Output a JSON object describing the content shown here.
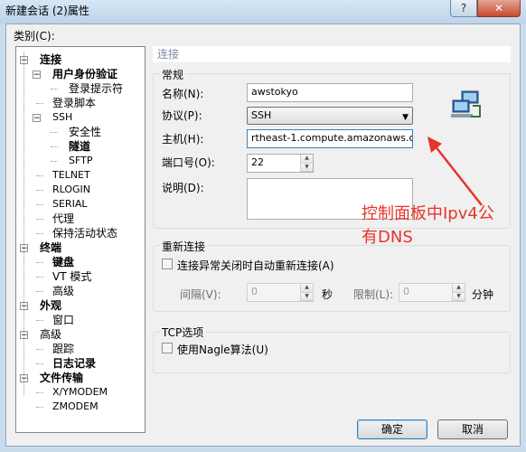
{
  "window": {
    "title": "新建会话 (2)属性",
    "help_label": "?",
    "close_label": "✕"
  },
  "category_label": "类别(C):",
  "tree": [
    {
      "label": "连接",
      "bold": true,
      "level": 0,
      "toggle": "⊟"
    },
    {
      "label": "用户身份验证",
      "bold": true,
      "level": 1,
      "toggle": "⊟"
    },
    {
      "label": "登录提示符",
      "bold": false,
      "level": 2
    },
    {
      "label": "登录脚本",
      "bold": false,
      "level": 1
    },
    {
      "label": "SSH",
      "bold": false,
      "level": 1,
      "toggle": "⊟",
      "small": true
    },
    {
      "label": "安全性",
      "bold": false,
      "level": 2
    },
    {
      "label": "隧道",
      "bold": true,
      "level": 2
    },
    {
      "label": "SFTP",
      "bold": false,
      "level": 2,
      "small": true
    },
    {
      "label": "TELNET",
      "bold": false,
      "level": 1,
      "small": true
    },
    {
      "label": "RLOGIN",
      "bold": false,
      "level": 1,
      "small": true
    },
    {
      "label": "SERIAL",
      "bold": false,
      "level": 1,
      "small": true
    },
    {
      "label": "代理",
      "bold": false,
      "level": 1
    },
    {
      "label": "保持活动状态",
      "bold": false,
      "level": 1
    },
    {
      "label": "终端",
      "bold": true,
      "level": 0,
      "toggle": "⊟"
    },
    {
      "label": "键盘",
      "bold": true,
      "level": 1
    },
    {
      "label": "VT 模式",
      "bold": false,
      "level": 1
    },
    {
      "label": "高级",
      "bold": false,
      "level": 1
    },
    {
      "label": "外观",
      "bold": true,
      "level": 0,
      "toggle": "⊟"
    },
    {
      "label": "窗口",
      "bold": false,
      "level": 1
    },
    {
      "label": "高级",
      "bold": false,
      "level": 0,
      "toggle": "⊟"
    },
    {
      "label": "跟踪",
      "bold": false,
      "level": 1
    },
    {
      "label": "日志记录",
      "bold": true,
      "level": 1
    },
    {
      "label": "文件传输",
      "bold": true,
      "level": 0,
      "toggle": "⊟"
    },
    {
      "label": "X/YMODEM",
      "bold": false,
      "level": 1,
      "small": true
    },
    {
      "label": "ZMODEM",
      "bold": false,
      "level": 1,
      "small": true
    }
  ],
  "section_title": "连接",
  "general": {
    "legend": "常规",
    "name_label": "名称(N):",
    "name_value": "awstokyo",
    "protocol_label": "协议(P):",
    "protocol_value": "SSH",
    "host_label": "主机(H):",
    "host_value": "rtheast-1.compute.amazonaws.com",
    "port_label": "端口号(O):",
    "port_value": "22",
    "desc_label": "说明(D):",
    "desc_value": "",
    "icon": "network-computers-icon"
  },
  "reconnect": {
    "legend": "重新连接",
    "checkbox_label": "连接异常关闭时自动重新连接(A)",
    "interval_label": "间隔(V):",
    "interval_value": "0",
    "interval_unit": "秒",
    "limit_label": "限制(L):",
    "limit_value": "0",
    "limit_unit": "分钟"
  },
  "tcp": {
    "legend": "TCP选项",
    "nagle_label": "使用Nagle算法(U)"
  },
  "buttons": {
    "ok": "确定",
    "cancel": "取消"
  },
  "annotation": {
    "line1": "控制面板中Ipv4公",
    "line2": "有DNS",
    "color": "#e8332a"
  }
}
